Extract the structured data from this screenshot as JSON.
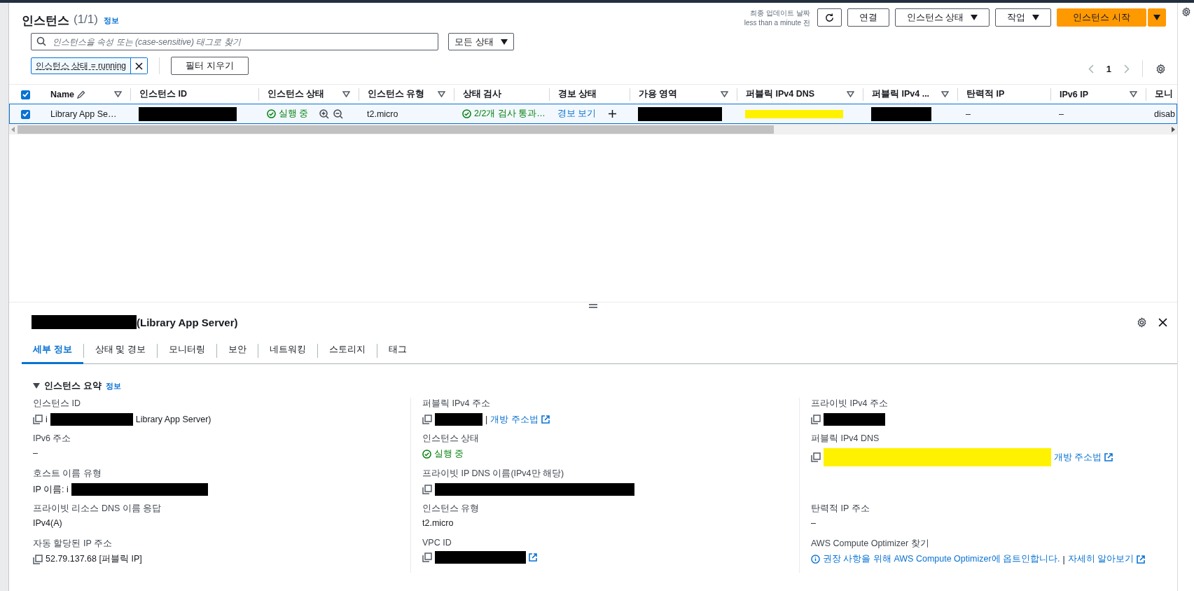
{
  "header": {
    "title": "인스턴스",
    "count": "(1/1)",
    "info": "정보",
    "updated_label": "최종 업데이트 날짜",
    "updated_value": "less than a minute 전"
  },
  "actions": [
    {
      "kind": "refresh"
    },
    {
      "kind": "button",
      "label": "연결"
    },
    {
      "kind": "dropdown",
      "label": "인스턴스 상태"
    },
    {
      "kind": "dropdown",
      "label": "작업"
    },
    {
      "kind": "primary",
      "label": "인스턴스 시작"
    }
  ],
  "search": {
    "placeholder": "인스턴스을 속성 또는 (case-sensitive) 태그로 찾기"
  },
  "state_filter": {
    "value": "모든 상태"
  },
  "filter_token": {
    "label": "인스턴스 상태 = running"
  },
  "clear_filters": "필터 지우기",
  "pagination": {
    "page": "1"
  },
  "table": {
    "all_checked": true,
    "columns": [
      {
        "label": "Name",
        "filter": true,
        "editable": true
      },
      {
        "label": "인스턴스 ID",
        "filter": false,
        "editable": false
      },
      {
        "label": "인스턴스 상태",
        "filter": true,
        "editable": false
      },
      {
        "label": "인스턴스 유형",
        "filter": true,
        "editable": false
      },
      {
        "label": "상태 검사",
        "filter": false,
        "editable": false
      },
      {
        "label": "경보 상태",
        "filter": false,
        "editable": false
      },
      {
        "label": "가용 영역",
        "filter": true,
        "editable": false
      },
      {
        "label": "퍼블릭 IPv4 DNS",
        "filter": true,
        "editable": false
      },
      {
        "label": "퍼블릭 IPv4 ...",
        "filter": true,
        "editable": false
      },
      {
        "label": "탄력적 IP",
        "filter": false,
        "editable": false
      },
      {
        "label": "IPv6 IP",
        "filter": true,
        "editable": false
      },
      {
        "label": "모니",
        "filter": false,
        "editable": false
      }
    ],
    "rows": [
      {
        "selected": true,
        "checked": true,
        "cells": [
          {
            "kind": "text",
            "text": "Library App Se…"
          },
          {
            "kind": "redacted",
            "color": "#000000"
          },
          {
            "kind": "status",
            "text": "실행 중"
          },
          {
            "kind": "text",
            "text": "t2.micro"
          },
          {
            "kind": "check",
            "text": "2/2개 검사 통과…"
          },
          {
            "kind": "alarm",
            "text": "경보 보기"
          },
          {
            "kind": "redacted",
            "color": "#000000"
          },
          {
            "kind": "redacted",
            "color": "#fff200"
          },
          {
            "kind": "redacted",
            "color": "#000000"
          },
          {
            "kind": "text",
            "text": "–"
          },
          {
            "kind": "text",
            "text": "–"
          },
          {
            "kind": "text",
            "text": "disab"
          }
        ]
      }
    ]
  },
  "details": {
    "title_suffix": "(Library App Server)",
    "tabs": [
      {
        "label": "세부 정보",
        "selected": true
      },
      {
        "label": "상태 및 경보",
        "selected": false
      },
      {
        "label": "모니터링",
        "selected": false
      },
      {
        "label": "보안",
        "selected": false
      },
      {
        "label": "네트워킹",
        "selected": false
      },
      {
        "label": "스토리지",
        "selected": false
      },
      {
        "label": "태그",
        "selected": false
      }
    ],
    "section": {
      "title": "인스턴스 요약",
      "info": "정보",
      "expanded": true
    },
    "columns": [
      [
        {
          "label": "인스턴스 ID",
          "copyable": true,
          "parts": [
            {
              "kind": "text",
              "text": "i"
            },
            {
              "kind": "redacted",
              "color": "#000000"
            },
            {
              "kind": "text",
              "text": "Library App Server)"
            }
          ]
        },
        {
          "label": "IPv6 주소",
          "copyable": false,
          "parts": [
            {
              "kind": "text",
              "text": "–"
            }
          ]
        },
        {
          "label": "호스트 이름 유형",
          "copyable": false,
          "parts": [
            {
              "kind": "text",
              "text": "IP 이름: i"
            },
            {
              "kind": "redacted",
              "color": "#000000"
            }
          ]
        },
        {
          "label": "프라이빗 리소스 DNS 이름 응답",
          "copyable": false,
          "parts": [
            {
              "kind": "text",
              "text": "IPv4(A)"
            }
          ]
        },
        {
          "label": "자동 할당된 IP 주소",
          "copyable": true,
          "parts": [
            {
              "kind": "text",
              "text": "52.79.137.68 [퍼블릭 IP]"
            }
          ]
        }
      ],
      [
        {
          "label": "퍼블릭 IPv4 주소",
          "copyable": true,
          "parts": [
            {
              "kind": "redacted",
              "color": "#000000"
            },
            {
              "kind": "text",
              "text": "|"
            },
            {
              "kind": "link",
              "text": "개방 주소법"
            },
            {
              "kind": "external"
            }
          ]
        },
        {
          "label": "인스턴스 상태",
          "copyable": false,
          "parts": [
            {
              "kind": "status",
              "text": "실행 중"
            }
          ]
        },
        {
          "label": "프라이빗 IP DNS 이름(IPv4만 해당)",
          "copyable": true,
          "parts": [
            {
              "kind": "redacted",
              "color": "#000000"
            }
          ]
        },
        {
          "label": "인스턴스 유형",
          "copyable": false,
          "parts": [
            {
              "kind": "text",
              "text": "t2.micro"
            }
          ]
        },
        {
          "label": "VPC ID",
          "copyable": true,
          "parts": [
            {
              "kind": "redacted",
              "color": "#000000"
            },
            {
              "kind": "external"
            }
          ]
        }
      ],
      [
        {
          "label": "프라이빗 IPv4 주소",
          "copyable": true,
          "parts": [
            {
              "kind": "redacted",
              "color": "#000000"
            }
          ]
        },
        {
          "label": "퍼블릭 IPv4 DNS",
          "copyable": true,
          "parts": [
            {
              "kind": "redacted",
              "color": "#fff200"
            },
            {
              "kind": "link",
              "text": "개방 주소법"
            },
            {
              "kind": "external"
            }
          ]
        },
        {
          "label": "탄력적 IP 주소",
          "copyable": false,
          "parts": [
            {
              "kind": "text",
              "text": "–"
            }
          ]
        },
        {
          "label": "AWS Compute Optimizer 찾기",
          "copyable": false,
          "parts": [
            {
              "kind": "info"
            },
            {
              "kind": "link",
              "text": "권장 사항을 위해 AWS Compute Optimizer에 옵트인합니다."
            },
            {
              "kind": "text",
              "text": "|"
            },
            {
              "kind": "link",
              "text": "자세히 알아보기"
            },
            {
              "kind": "external"
            }
          ]
        }
      ]
    ]
  }
}
